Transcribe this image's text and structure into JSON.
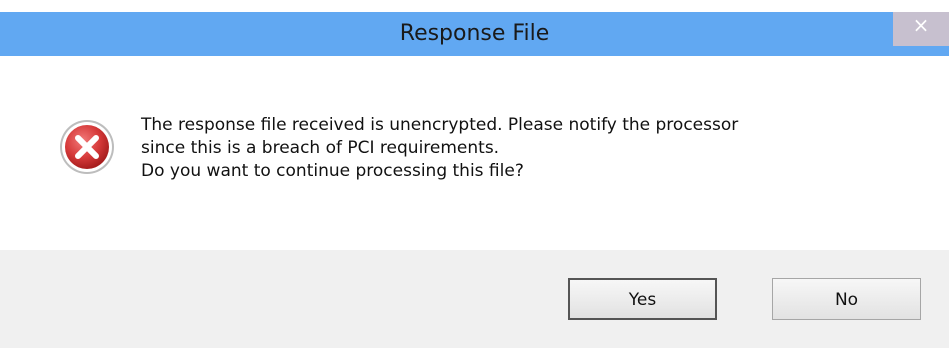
{
  "dialog": {
    "title": "Response File",
    "close_glyph": "×",
    "message_lines": [
      "The response file received is unencrypted. Please notify the processor",
      "since this is a breach of PCI requirements.",
      "Do you want to continue processing this file?"
    ],
    "icon": "error-icon",
    "buttons": {
      "yes": "Yes",
      "no": "No"
    },
    "colors": {
      "titlebar": "#61a8f2",
      "close_button": "#c7c0cf",
      "error_red": "#d63a3a",
      "footer": "#f0f0f0"
    }
  }
}
